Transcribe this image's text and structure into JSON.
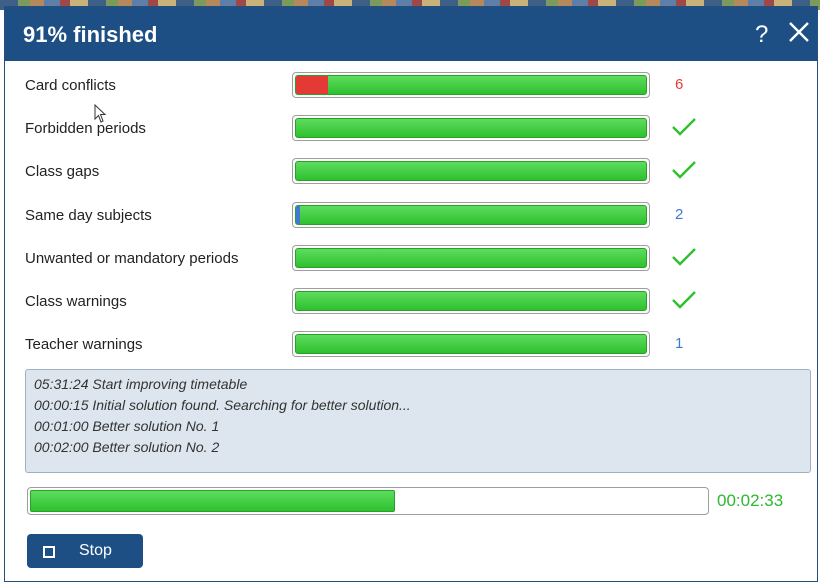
{
  "dialog": {
    "title": "91% finished",
    "help_label": "?"
  },
  "colors": {
    "header": "#1d4f84",
    "ok_green": "#2ec02e",
    "conflict_red": "#e53935",
    "warning_blue": "#3f78d6"
  },
  "rows": [
    {
      "label": "Card conflicts",
      "status": "count",
      "value": "6",
      "problem_fraction": 0.09,
      "problem_color": "#e53935",
      "status_color": "#e53935"
    },
    {
      "label": "Forbidden periods",
      "status": "ok",
      "value": "",
      "problem_fraction": 0,
      "problem_color": "",
      "status_color": "#2ec02e"
    },
    {
      "label": "Class gaps",
      "status": "ok",
      "value": "",
      "problem_fraction": 0,
      "problem_color": "",
      "status_color": "#2ec02e"
    },
    {
      "label": "Same day subjects",
      "status": "count",
      "value": "2",
      "problem_fraction": 0.01,
      "problem_color": "#3f78d6",
      "status_color": "#3f78d6"
    },
    {
      "label": "Unwanted or mandatory periods",
      "status": "ok",
      "value": "",
      "problem_fraction": 0,
      "problem_color": "",
      "status_color": "#2ec02e"
    },
    {
      "label": "Class warnings",
      "status": "ok",
      "value": "",
      "problem_fraction": 0,
      "problem_color": "",
      "status_color": "#2ec02e"
    },
    {
      "label": "Teacher warnings",
      "status": "count",
      "value": "1",
      "problem_fraction": 0,
      "problem_color": "",
      "status_color": "#3f78d6"
    }
  ],
  "log": [
    "05:31:24 Start improving timetable",
    "00:00:15 Initial solution found. Searching for better solution...",
    "00:01:00 Better solution No. 1",
    "00:02:00 Better solution No. 2"
  ],
  "progress": {
    "fraction": 0.54,
    "elapsed": "00:02:33"
  },
  "stop_button": {
    "label": "Stop"
  }
}
